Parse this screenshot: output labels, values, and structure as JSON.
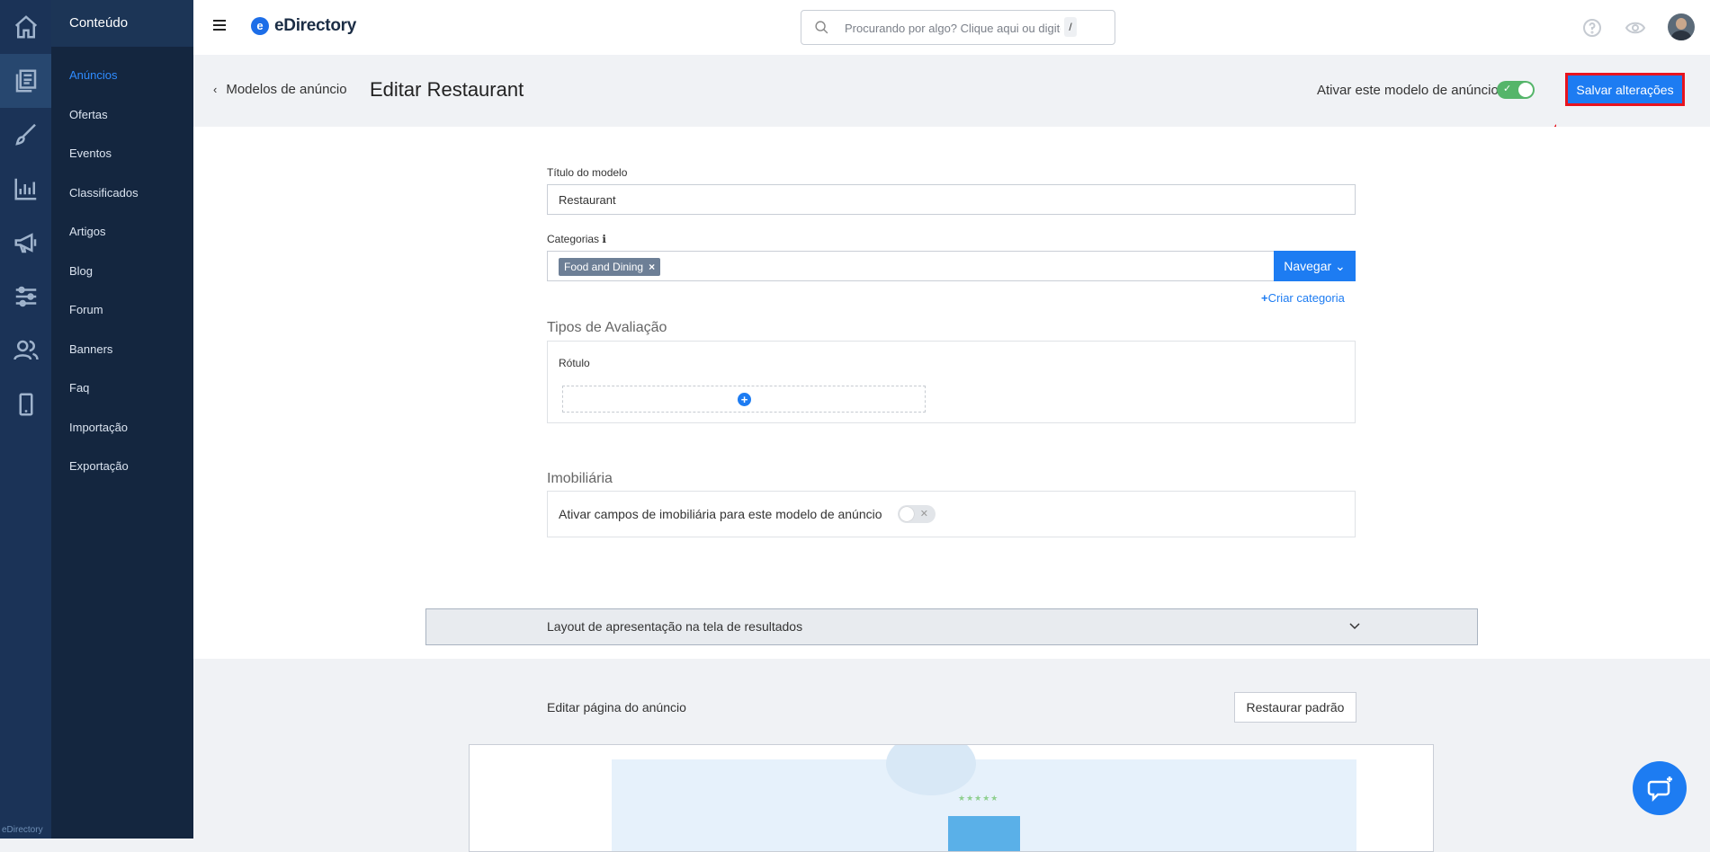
{
  "app": {
    "logo": "eDirectory",
    "logo_mark": "e",
    "rail_brand": "eDirectory"
  },
  "subnav": {
    "header": "Conteúdo",
    "items": [
      {
        "label": "Anúncios",
        "active": true
      },
      {
        "label": "Ofertas"
      },
      {
        "label": "Eventos"
      },
      {
        "label": "Classificados"
      },
      {
        "label": "Artigos"
      },
      {
        "label": "Blog"
      },
      {
        "label": "Forum"
      },
      {
        "label": "Banners"
      },
      {
        "label": "Faq"
      },
      {
        "label": "Importação"
      },
      {
        "label": "Exportação"
      }
    ]
  },
  "topbar": {
    "search_placeholder": "Procurando por algo? Clique aqui ou digite",
    "search_shortcut": "/"
  },
  "header": {
    "back_label": "Modelos de anúncio",
    "title": "Editar Restaurant",
    "activate_label": "Ativar este modelo de anúncio",
    "activate_on": true,
    "save_label": "Salvar alterações"
  },
  "form": {
    "title_label": "Título do modelo",
    "title_value": "Restaurant",
    "categories_label": "Categorias",
    "categories_info": "ℹ",
    "category_tag": "Food and Dining",
    "tag_remove": "×",
    "browse_label": "Navegar",
    "create_category_plus": "+",
    "create_category_label": "Criar categoria",
    "review_section_title": "Tipos de Avaliação",
    "rating_label": "Rótulo",
    "add_rating_plus": "+",
    "realestate_section_title": "Imobiliária",
    "realestate_label": "Ativar campos de imobiliária para este modelo de anúncio",
    "realestate_on": false,
    "collapse_label": "Layout de apresentação na tela de resultados"
  },
  "bottom": {
    "edit_page_label": "Editar página do anúncio",
    "restore_label": "Restaurar padrão",
    "preview_stars": "★★★★★"
  },
  "colors": {
    "accent": "#1d7cf2",
    "highlight": "#e8141e",
    "toggle_on": "#55b56a",
    "rail": "#1b3357"
  }
}
